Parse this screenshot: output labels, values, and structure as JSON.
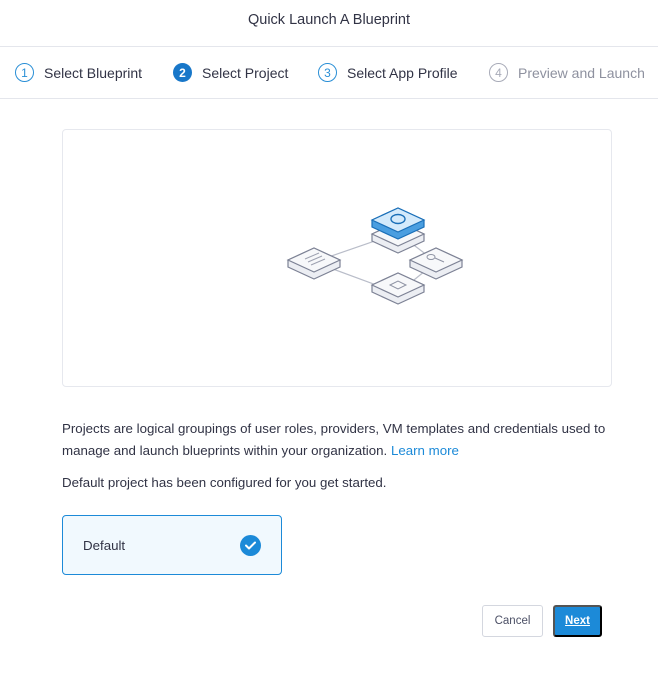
{
  "dialog": {
    "title": "Quick Launch A Blueprint"
  },
  "steps": [
    {
      "number": "1",
      "label": "Select Blueprint",
      "state": "done"
    },
    {
      "number": "2",
      "label": "Select Project",
      "state": "active"
    },
    {
      "number": "3",
      "label": "Select App Profile",
      "state": "upcoming"
    },
    {
      "number": "4",
      "label": "Preview and Launch",
      "state": "disabled"
    }
  ],
  "description": {
    "text": "Projects are logical groupings of user roles, providers, VM templates and credentials used to manage and launch blueprints within your organization. ",
    "link": "Learn more"
  },
  "note": "Default project has been configured for you get started.",
  "project": {
    "name": "Default",
    "selected": true,
    "icon": "check-icon"
  },
  "buttons": {
    "cancel": "Cancel",
    "next": "Next"
  },
  "colors": {
    "accent": "#1c8ad8",
    "selected_bg": "#f1f9fe",
    "text": "#313345",
    "disabled": "#8e919f"
  }
}
